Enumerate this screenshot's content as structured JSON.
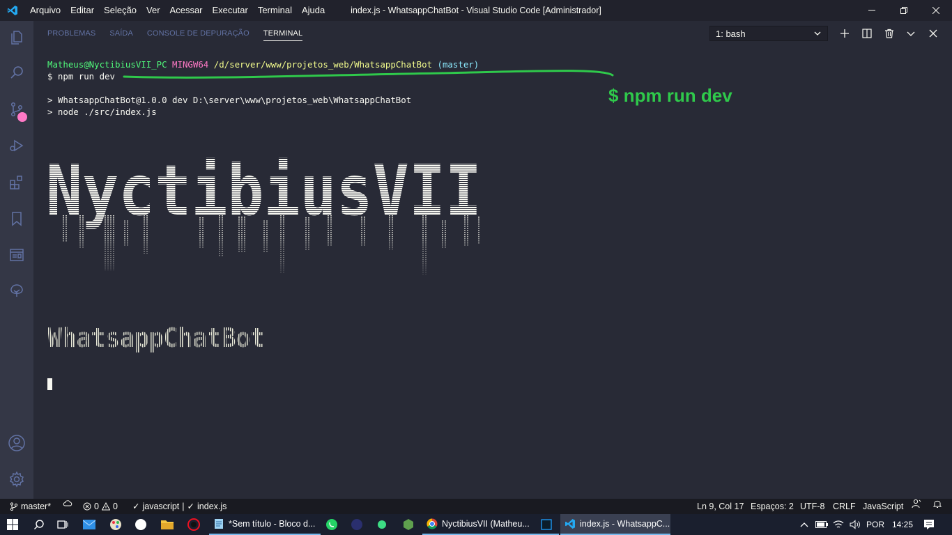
{
  "titlebar": {
    "menu": [
      "Arquivo",
      "Editar",
      "Seleção",
      "Ver",
      "Acessar",
      "Executar",
      "Terminal",
      "Ajuda"
    ],
    "window_title": "index.js - WhatsappChatBot - Visual Studio Code [Administrador]"
  },
  "activitybar": {
    "items": [
      "explorer-icon",
      "search-icon",
      "source-control-icon",
      "run-debug-icon",
      "extensions-icon",
      "bookmarks-icon",
      "remote-explorer-icon",
      "tree-icon",
      "account-icon",
      "manage-gear-icon"
    ]
  },
  "panel": {
    "tabs": [
      "PROBLEMAS",
      "SAÍDA",
      "CONSOLE DE DEPURAÇÃO",
      "TERMINAL"
    ],
    "active_tab": "TERMINAL",
    "terminal_select": "1: bash"
  },
  "terminal": {
    "prompt_user": "Matheus@NyctibiusVII_PC",
    "prompt_shell": "MINGW64",
    "prompt_path": "/d/server/www/projetos_web/WhatsappChatBot",
    "prompt_branch": "(master)",
    "command": "$ npm run dev",
    "output_line1": "> WhatsappChatBot@1.0.0 dev D:\\server\\www\\projetos_web\\WhatsappChatBot",
    "output_line2": "> node ./src/index.js",
    "banner_text": "NyctibiusVII",
    "subtitle_text": "WhatsappChatBot"
  },
  "annotation": {
    "text": "$ npm run dev",
    "color": "#2fc94b"
  },
  "statusbar": {
    "branch": "master*",
    "errors": "0",
    "warnings": "0",
    "check_language": "javascript",
    "check_file": "index.js",
    "position": "Ln 9, Col 17",
    "spaces": "Espaços: 2",
    "encoding": "UTF-8",
    "eol": "CRLF",
    "language": "JavaScript"
  },
  "taskbar": {
    "tasks": {
      "notepad": "*Sem título - Bloco d...",
      "chrome": "NyctibiusVII (Matheu...",
      "vscode": "index.js - WhatsappC..."
    },
    "lang": "POR",
    "time": "14:25"
  },
  "colors": {
    "background": "#282a36",
    "prompt_green": "#50fa7b",
    "prompt_pink": "#ff79c6",
    "path_yellow": "#f1fa8c",
    "branch_cyan": "#8be9fd"
  }
}
